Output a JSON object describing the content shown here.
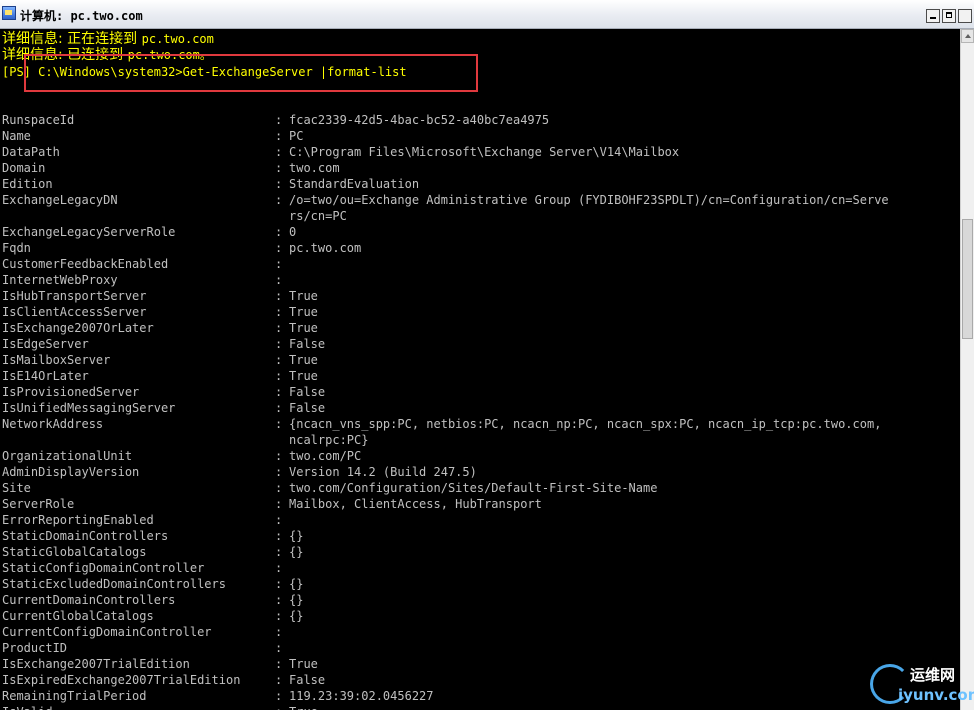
{
  "window": {
    "title": "计算机: pc.two.com",
    "controls": [
      "minimize",
      "maximize",
      "close"
    ]
  },
  "console": {
    "verbose_lines": [
      {
        "prefix": "详细信息: 正在连接到 ",
        "value": "pc.two.com"
      },
      {
        "prefix": "详细信息: 已连接到 ",
        "value": "pc.two.com。"
      }
    ],
    "prompt": "[PS] C:\\Windows\\system32>",
    "command": "Get-ExchangeServer |format-list",
    "separator": ":",
    "properties": [
      {
        "name": "RunspaceId",
        "value": "fcac2339-42d5-4bac-bc52-a40bc7ea4975"
      },
      {
        "name": "Name",
        "value": "PC"
      },
      {
        "name": "DataPath",
        "value": "C:\\Program Files\\Microsoft\\Exchange Server\\V14\\Mailbox"
      },
      {
        "name": "Domain",
        "value": "two.com"
      },
      {
        "name": "Edition",
        "value": "StandardEvaluation"
      },
      {
        "name": "ExchangeLegacyDN",
        "value": "/o=two/ou=Exchange Administrative Group (FYDIBOHF23SPDLT)/cn=Configuration/cn=Serve",
        "cont": "rs/cn=PC"
      },
      {
        "name": "ExchangeLegacyServerRole",
        "value": "0"
      },
      {
        "name": "Fqdn",
        "value": "pc.two.com"
      },
      {
        "name": "CustomerFeedbackEnabled",
        "value": ""
      },
      {
        "name": "InternetWebProxy",
        "value": ""
      },
      {
        "name": "IsHubTransportServer",
        "value": "True"
      },
      {
        "name": "IsClientAccessServer",
        "value": "True"
      },
      {
        "name": "IsExchange2007OrLater",
        "value": "True"
      },
      {
        "name": "IsEdgeServer",
        "value": "False"
      },
      {
        "name": "IsMailboxServer",
        "value": "True"
      },
      {
        "name": "IsE14OrLater",
        "value": "True"
      },
      {
        "name": "IsProvisionedServer",
        "value": "False"
      },
      {
        "name": "IsUnifiedMessagingServer",
        "value": "False"
      },
      {
        "name": "NetworkAddress",
        "value": "{ncacn_vns_spp:PC, netbios:PC, ncacn_np:PC, ncacn_spx:PC, ncacn_ip_tcp:pc.two.com,",
        "cont": "ncalrpc:PC}"
      },
      {
        "name": "OrganizationalUnit",
        "value": "two.com/PC"
      },
      {
        "name": "AdminDisplayVersion",
        "value": "Version 14.2 (Build 247.5)"
      },
      {
        "name": "Site",
        "value": "two.com/Configuration/Sites/Default-First-Site-Name"
      },
      {
        "name": "ServerRole",
        "value": "Mailbox, ClientAccess, HubTransport"
      },
      {
        "name": "ErrorReportingEnabled",
        "value": ""
      },
      {
        "name": "StaticDomainControllers",
        "value": "{}"
      },
      {
        "name": "StaticGlobalCatalogs",
        "value": "{}"
      },
      {
        "name": "StaticConfigDomainController",
        "value": ""
      },
      {
        "name": "StaticExcludedDomainControllers",
        "value": "{}"
      },
      {
        "name": "CurrentDomainControllers",
        "value": "{}"
      },
      {
        "name": "CurrentGlobalCatalogs",
        "value": "{}"
      },
      {
        "name": "CurrentConfigDomainController",
        "value": ""
      },
      {
        "name": "ProductID",
        "value": ""
      },
      {
        "name": "IsExchange2007TrialEdition",
        "value": "True"
      },
      {
        "name": "IsExpiredExchange2007TrialEdition",
        "value": "False"
      },
      {
        "name": "RemainingTrialPeriod",
        "value": "119.23:39:02.0456227"
      },
      {
        "name": "IsValid",
        "value": "True"
      }
    ]
  },
  "watermark": {
    "text_cn": "运维网",
    "url": "iyunv.com"
  },
  "colors": {
    "console_bg": "#000000",
    "console_fg": "#c0c0c0",
    "verbose": "#ffff00",
    "highlight_box": "#e0393e"
  }
}
